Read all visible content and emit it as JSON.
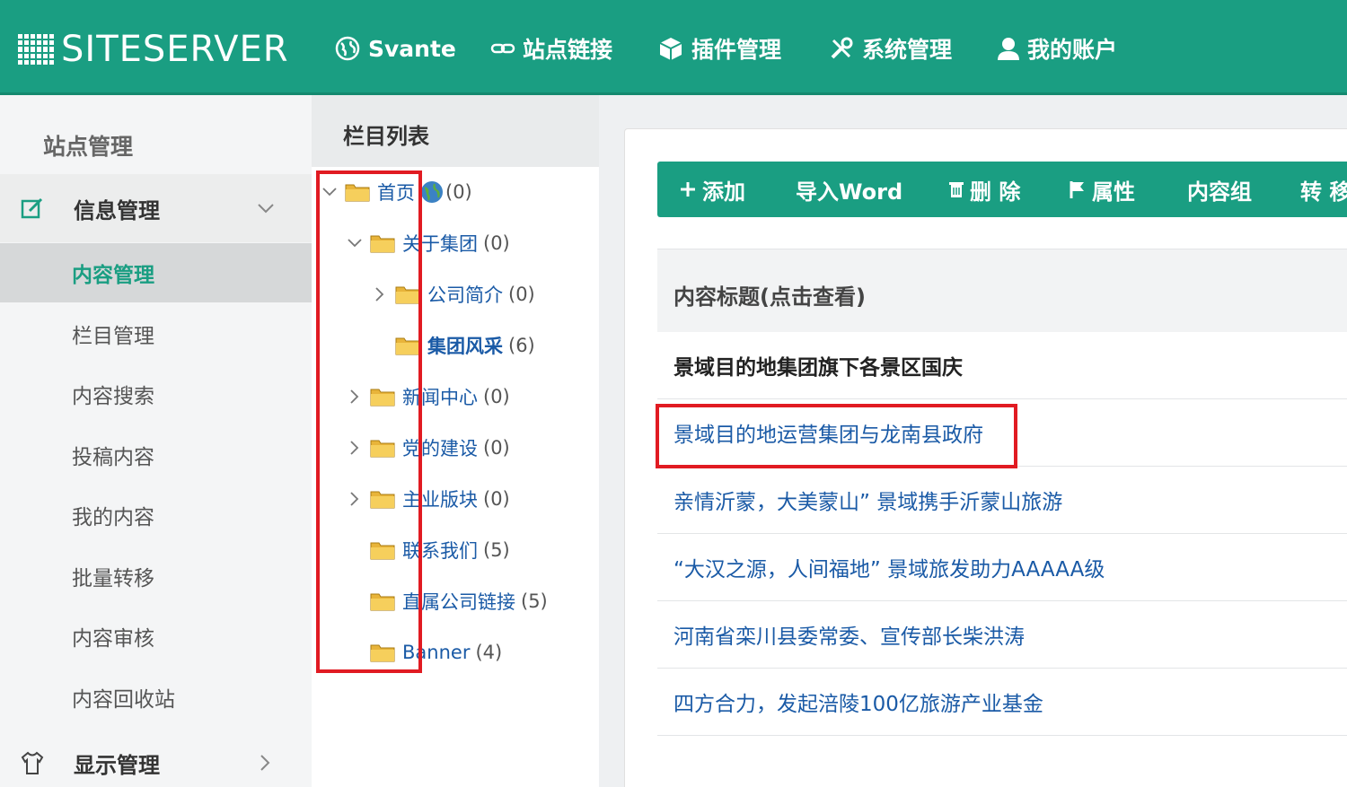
{
  "brand": {
    "logo_text": "SITESERVER"
  },
  "topnav": {
    "items": [
      {
        "label": "Svante",
        "icon": "globe-icon"
      },
      {
        "label": "站点链接",
        "icon": "link-icon"
      },
      {
        "label": "插件管理",
        "icon": "cube-icon"
      },
      {
        "label": "系统管理",
        "icon": "tools-icon"
      },
      {
        "label": "我的账户",
        "icon": "user-icon"
      }
    ]
  },
  "sidebar": {
    "title": "站点管理",
    "group_info": {
      "label": "信息管理",
      "icon": "edit-icon"
    },
    "items": [
      {
        "label": "内容管理",
        "active": true
      },
      {
        "label": "栏目管理"
      },
      {
        "label": "内容搜索"
      },
      {
        "label": "投稿内容"
      },
      {
        "label": "我的内容"
      },
      {
        "label": "批量转移"
      },
      {
        "label": "内容审核"
      },
      {
        "label": "内容回收站"
      }
    ],
    "group_display": {
      "label": "显示管理",
      "icon": "tshirt-icon"
    }
  },
  "tree": {
    "header": "栏目列表",
    "nodes": [
      {
        "label": "首页",
        "count": "(0)"
      },
      {
        "label": "关于集团",
        "count": "(0)"
      },
      {
        "label": "公司简介",
        "count": "(0)"
      },
      {
        "label": "集团风采",
        "count": "(6)"
      },
      {
        "label": "新闻中心",
        "count": "(0)"
      },
      {
        "label": "党的建设",
        "count": "(0)"
      },
      {
        "label": "主业版块",
        "count": "(0)"
      },
      {
        "label": "联系我们",
        "count": "(5)"
      },
      {
        "label": "直属公司链接",
        "count": "(5)"
      },
      {
        "label": "Banner",
        "count": "(4)"
      }
    ]
  },
  "toolbar": {
    "buttons": [
      {
        "label": "添加",
        "icon": "plus-icon"
      },
      {
        "label": "导入Word"
      },
      {
        "label": "删 除",
        "icon": "trash-icon"
      },
      {
        "label": "属性",
        "icon": "flag-icon"
      },
      {
        "label": "内容组"
      },
      {
        "label": "转 移"
      }
    ]
  },
  "table": {
    "header": "内容标题(点击查看)",
    "rows": [
      "景域目的地集团旗下各景区国庆",
      "景域目的地运营集团与龙南县政府",
      "亲情沂蒙，大美蒙山” 景域携手沂蒙山旅游",
      " “大汉之源，人间福地” 景域旅发助力AAAAA级",
      "河南省栾川县委常委、宣传部长柴洪涛",
      "四方合力，发起涪陵100亿旅游产业基金"
    ]
  },
  "colors": {
    "primary": "#1a9e82",
    "highlight_box": "#e11b22",
    "link": "#1a5aa6"
  }
}
